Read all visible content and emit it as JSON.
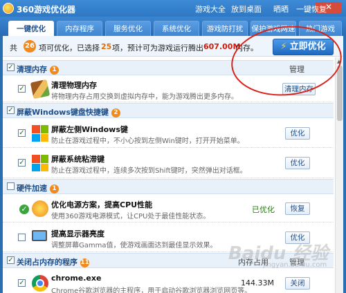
{
  "window": {
    "title": "360游戏优化器",
    "links": [
      "游戏大全",
      "放到桌面",
      "晒晒",
      "一键恢复"
    ],
    "minimize": "_",
    "close": "✕"
  },
  "tabs": [
    "一键优化",
    "内存程序",
    "服务优化",
    "系统优化",
    "游戏防打扰",
    "保护游戏网速",
    "热门游戏"
  ],
  "summary": {
    "prefix": "共",
    "total": "26",
    "mid1": "项可优化，已选择",
    "selected": "25",
    "mid2": "项，预计可为游戏运行腾出",
    "memory": "607.00M",
    "suffix": "内存。",
    "button": "立即优化"
  },
  "groups": {
    "clean": {
      "title": "清理内存",
      "count": "1",
      "right": "管理"
    },
    "winkey": {
      "title": "屏蔽Windows键盘快捷键",
      "count": "2"
    },
    "hardware": {
      "title": "硬件加速",
      "count": "1"
    },
    "programs": {
      "title": "关闭占内存的程序",
      "count": "11",
      "right": "内存占用",
      "right2": "管理"
    }
  },
  "items": {
    "clean_mem": {
      "title": "清理物理内存",
      "desc": "将物理内存占用交换到虚拟内存中，能为游戏腾出更多内存。",
      "button": "清理内存"
    },
    "left_win": {
      "title": "屏蔽左侧Windows键",
      "desc": "防止在游戏过程中，不小心按到左侧Win键时，打开开始菜单。",
      "button": "优化"
    },
    "sticky": {
      "title": "屏蔽系统粘滞键",
      "desc": "防止在游戏过程中，连续多次按到Shift键时，突然弹出对话框。",
      "button": "优化"
    },
    "cpu": {
      "title": "优化电源方案，提高CPU性能",
      "desc": "使用360游戏电源模式，让CPU处于最佳性能状态。",
      "status": "已优化",
      "button": "恢复"
    },
    "gamma": {
      "title": "提高显示器亮度",
      "desc": "调整屏幕Gamma值，使游戏画面达到最佳显示效果。",
      "button": "优化"
    },
    "chrome": {
      "title": "chrome.exe",
      "desc": "Chrome谷歌浏览器的主程序，用于启动谷歌浏览器浏览网页等。",
      "memory": "144.33M",
      "button": "关闭"
    }
  },
  "checkmark": "✓",
  "watermark": "Baidu 经验",
  "watermark_sub": "jingyan.baidu.com"
}
